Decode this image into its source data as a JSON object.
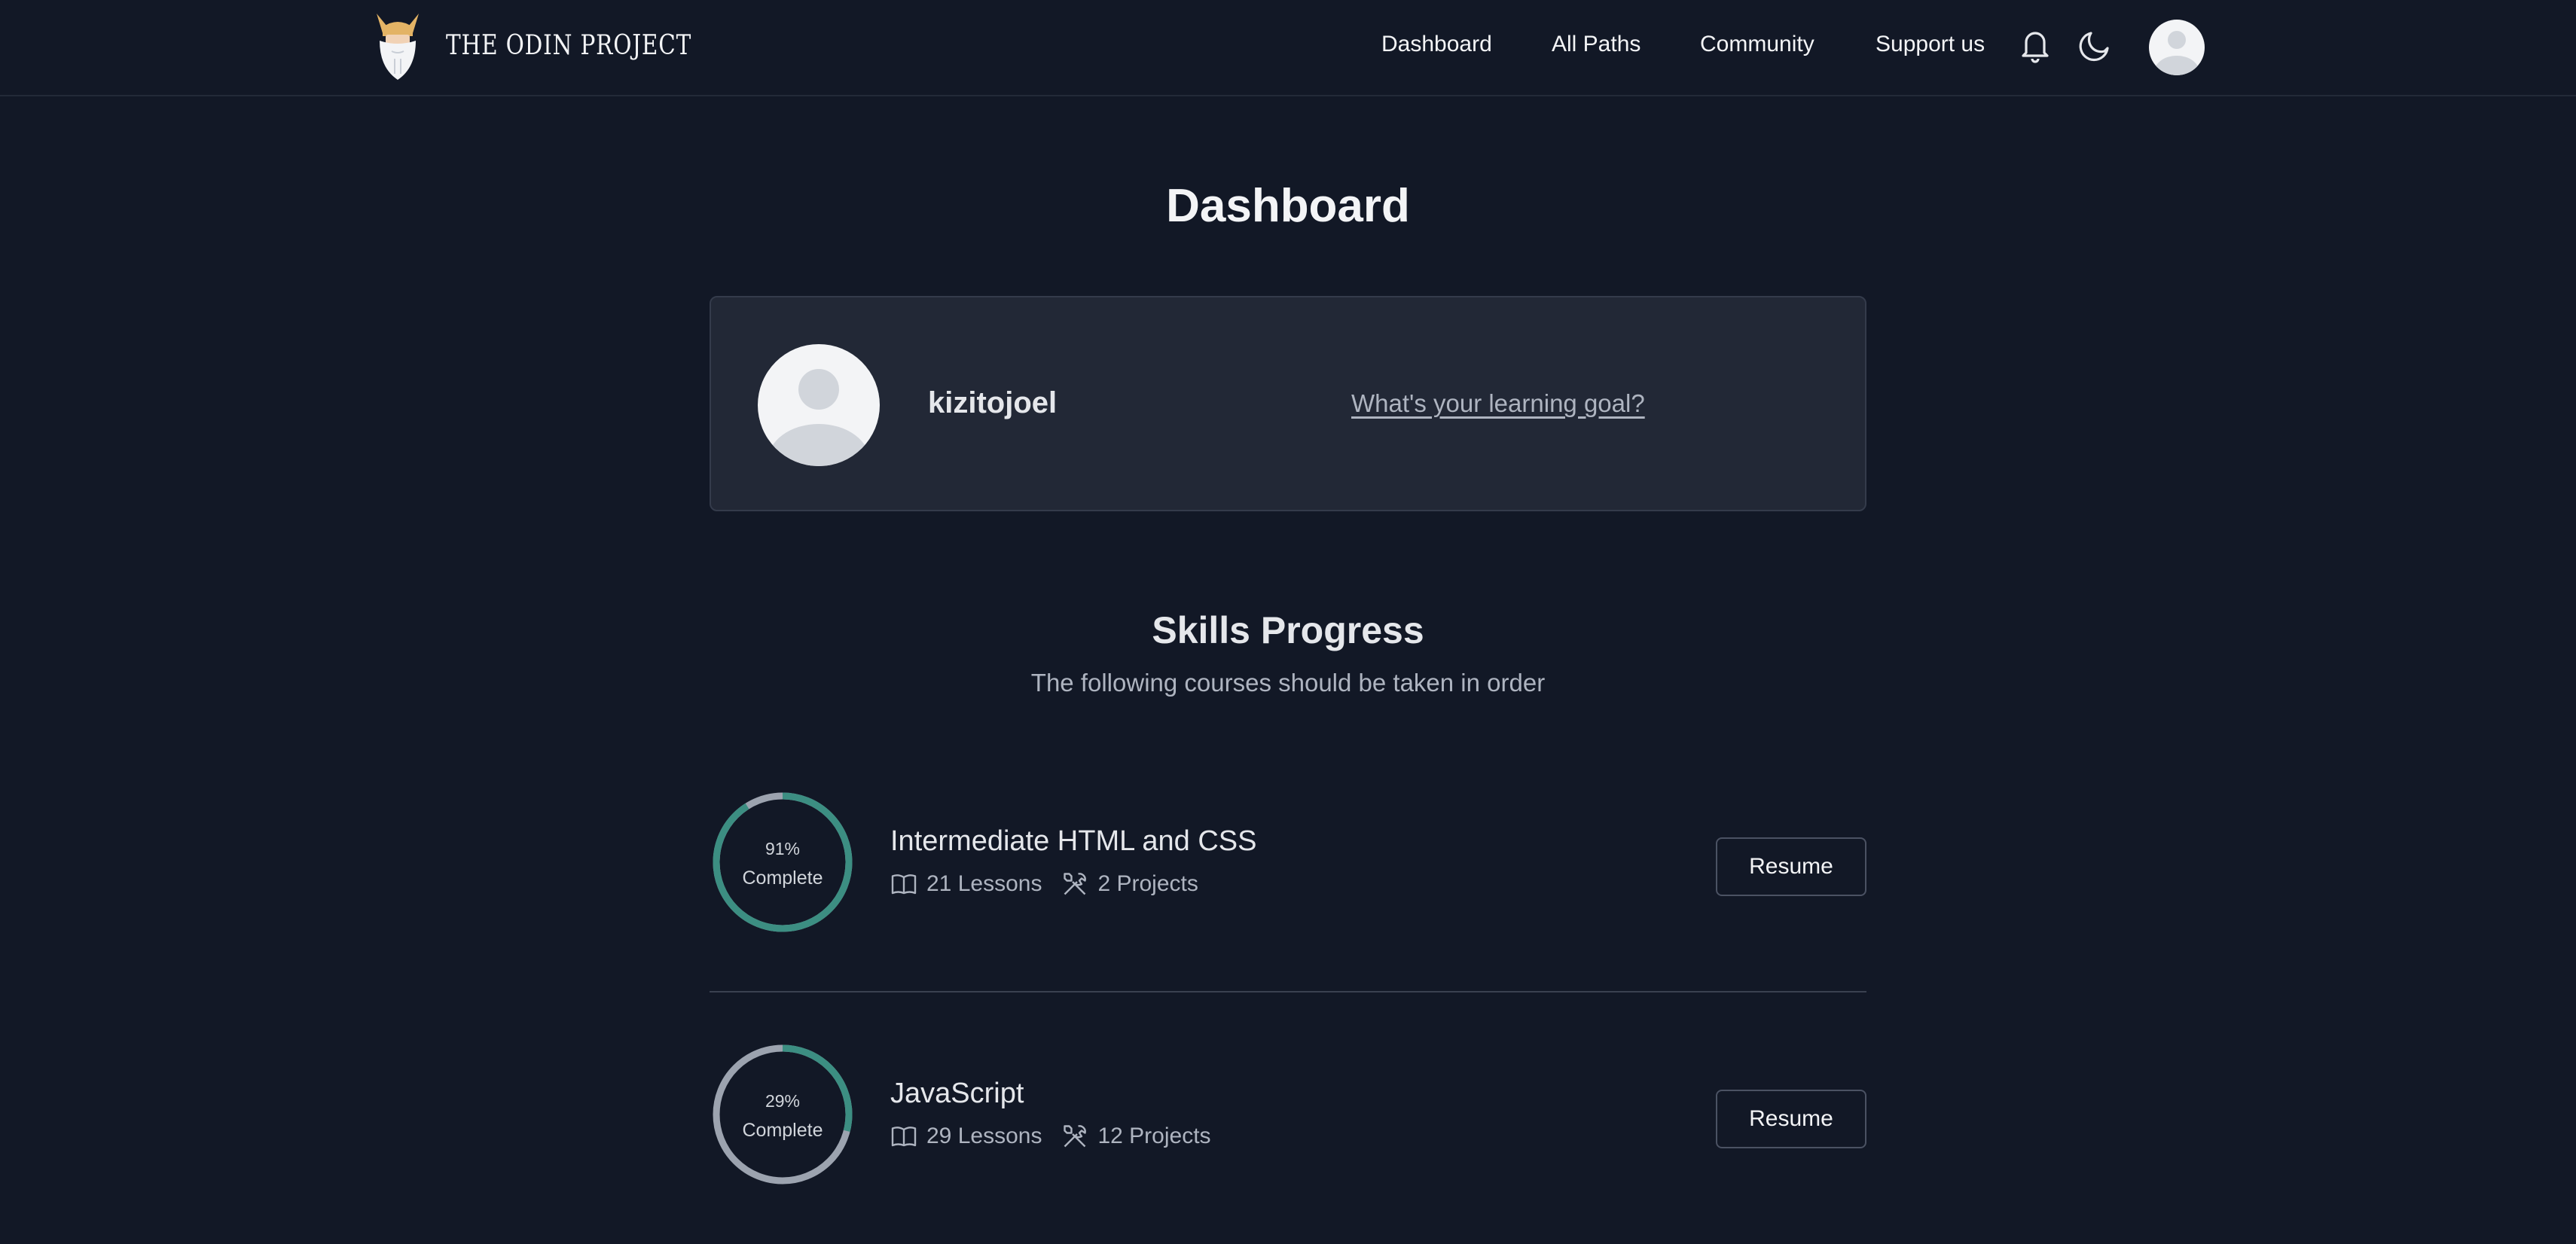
{
  "brand": {
    "name": "THE ODIN PROJECT"
  },
  "nav": {
    "links": [
      "Dashboard",
      "All Paths",
      "Community",
      "Support us"
    ],
    "icons": [
      "bell-icon",
      "moon-icon",
      "user-avatar"
    ]
  },
  "page": {
    "title": "Dashboard"
  },
  "profile": {
    "username": "kizitojoel",
    "goal_link": "What's your learning goal?"
  },
  "skills": {
    "title": "Skills Progress",
    "subtitle": "The following courses should be taken in order",
    "courses": [
      {
        "percent_text": "91%",
        "percent_value": 91,
        "complete_label": "Complete",
        "title": "Intermediate HTML and CSS",
        "lessons": "21 Lessons",
        "projects": "2 Projects",
        "button": "Resume"
      },
      {
        "percent_text": "29%",
        "percent_value": 29,
        "complete_label": "Complete",
        "title": "JavaScript",
        "lessons": "29 Lessons",
        "projects": "12 Projects",
        "button": "Resume"
      }
    ]
  },
  "colors": {
    "background": "#121826",
    "card": "#222836",
    "progress": "#3c8e82",
    "track": "#9ca3af",
    "logo_horns": "#e3b365"
  }
}
